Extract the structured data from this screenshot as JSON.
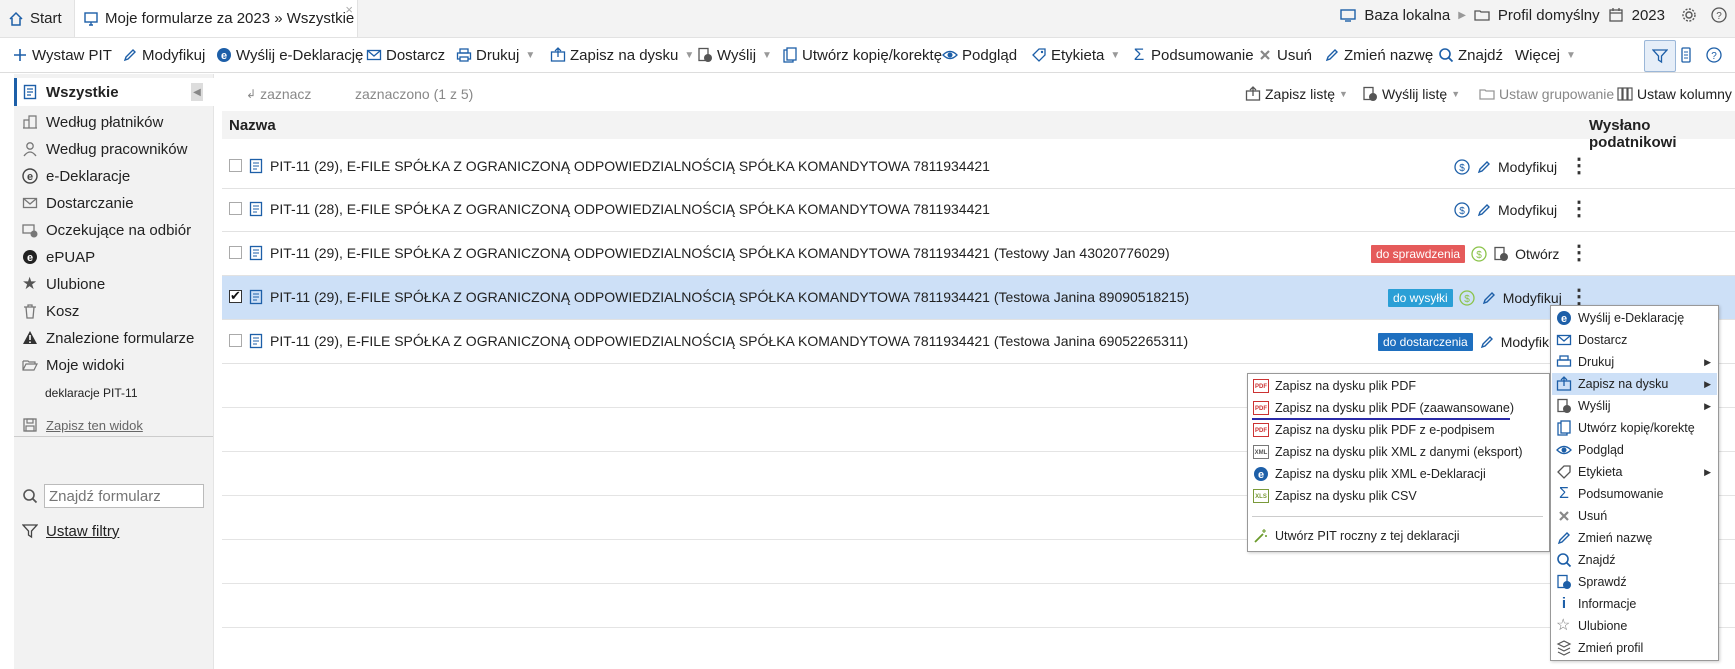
{
  "tabs": {
    "start": "Start",
    "forms": "Moje formularze za 2023 » Wszystkie",
    "close": "×"
  },
  "topright": {
    "database": "Baza lokalna",
    "profile": "Profil domyślny",
    "year": "2023"
  },
  "toolbar": {
    "issue_pit": "Wystaw PIT",
    "modify": "Modyfikuj",
    "send_edecl": "Wyślij e-Deklarację",
    "deliver": "Dostarcz",
    "print": "Drukuj",
    "save_disk": "Zapisz na dysku",
    "send": "Wyślij",
    "copy_correction": "Utwórz kopię/korektę",
    "preview": "Podgląd",
    "label": "Etykieta",
    "summary": "Podsumowanie",
    "delete": "Usuń",
    "rename": "Zmień nazwę",
    "find": "Znajdź",
    "more": "Więcej"
  },
  "sidebar": {
    "items": [
      {
        "label": "Wszystkie"
      },
      {
        "label": "Według płatników"
      },
      {
        "label": "Według pracowników"
      },
      {
        "label": "e-Deklaracje"
      },
      {
        "label": "Dostarczanie"
      },
      {
        "label": "Oczekujące na odbiór"
      },
      {
        "label": "ePUAP"
      },
      {
        "label": "Ulubione"
      },
      {
        "label": "Kosz"
      },
      {
        "label": "Znalezione formularze"
      },
      {
        "label": "Moje widoki"
      }
    ],
    "sub_view": "deklaracje PIT-11",
    "save_view": "Zapisz ten widok",
    "search_placeholder": "Znajdź formularz",
    "set_filters": "Ustaw filtry"
  },
  "subbar": {
    "mark": "zaznacz",
    "marked": "zaznaczono (1 z 5)",
    "save_list": "Zapisz listę",
    "send_list": "Wyślij listę",
    "set_grouping": "Ustaw grupowanie",
    "set_columns": "Ustaw kolumny"
  },
  "grid": {
    "col_name": "Nazwa",
    "col_sent": "Wysłano podatnikowi",
    "rows": [
      {
        "name": "PIT-11 (29), E-FILE SPÓŁKA Z OGRANICZONĄ ODPOWIEDZIALNOŚCIĄ SPÓŁKA KOMANDYTOWA 7811934421",
        "badge": "",
        "action": "Modyfikuj",
        "checked": false
      },
      {
        "name": "PIT-11 (28), E-FILE SPÓŁKA Z OGRANICZONĄ ODPOWIEDZIALNOŚCIĄ SPÓŁKA KOMANDYTOWA 7811934421",
        "badge": "",
        "action": "Modyfikuj",
        "checked": false
      },
      {
        "name": "PIT-11 (29), E-FILE SPÓŁKA Z OGRANICZONĄ ODPOWIEDZIALNOŚCIĄ SPÓŁKA KOMANDYTOWA 7811934421 (Testowy Jan 43020776029)",
        "badge": "do sprawdzenia",
        "action": "Otwórz",
        "checked": false
      },
      {
        "name": "PIT-11 (29), E-FILE SPÓŁKA Z OGRANICZONĄ ODPOWIEDZIALNOŚCIĄ SPÓŁKA KOMANDYTOWA 7811934421 (Testowa Janina 89090518215)",
        "badge": "do wysyłki",
        "action": "Modyfikuj",
        "checked": true
      },
      {
        "name": "PIT-11 (29), E-FILE SPÓŁKA Z OGRANICZONĄ ODPOWIEDZIALNOŚCIĄ SPÓŁKA KOMANDYTOWA 7811934421 (Testowa Janina 69052265311)",
        "badge": "do dostarczenia",
        "action": "Modyfikuj",
        "checked": false
      }
    ]
  },
  "context_menu": {
    "items": [
      "Wyślij e-Deklarację",
      "Dostarcz",
      "Drukuj",
      "Zapisz na dysku",
      "Wyślij",
      "Utwórz kopię/korektę",
      "Podgląd",
      "Etykieta",
      "Podsumowanie",
      "Usuń",
      "Zmień nazwę",
      "Znajdź",
      "Sprawdź",
      "Informacje",
      "Ulubione",
      "Zmień profil"
    ]
  },
  "submenu": {
    "items": [
      "Zapisz na dysku plik PDF",
      "Zapisz na dysku plik PDF (zaawansowane)",
      "Zapisz na dysku plik PDF z e-podpisem",
      "Zapisz na dysku plik XML z danymi (eksport)",
      "Zapisz na dysku plik XML e-Deklaracji",
      "Zapisz na dysku plik CSV"
    ],
    "create_annual": "Utwórz PIT roczny z tej deklaracji"
  },
  "colors": {
    "accent": "#1d5fa8",
    "badge_check": "#e55a5a",
    "badge_send": "#2a9fd6",
    "badge_deliver": "#1e6fbf",
    "selected_row": "#cde0f7"
  }
}
